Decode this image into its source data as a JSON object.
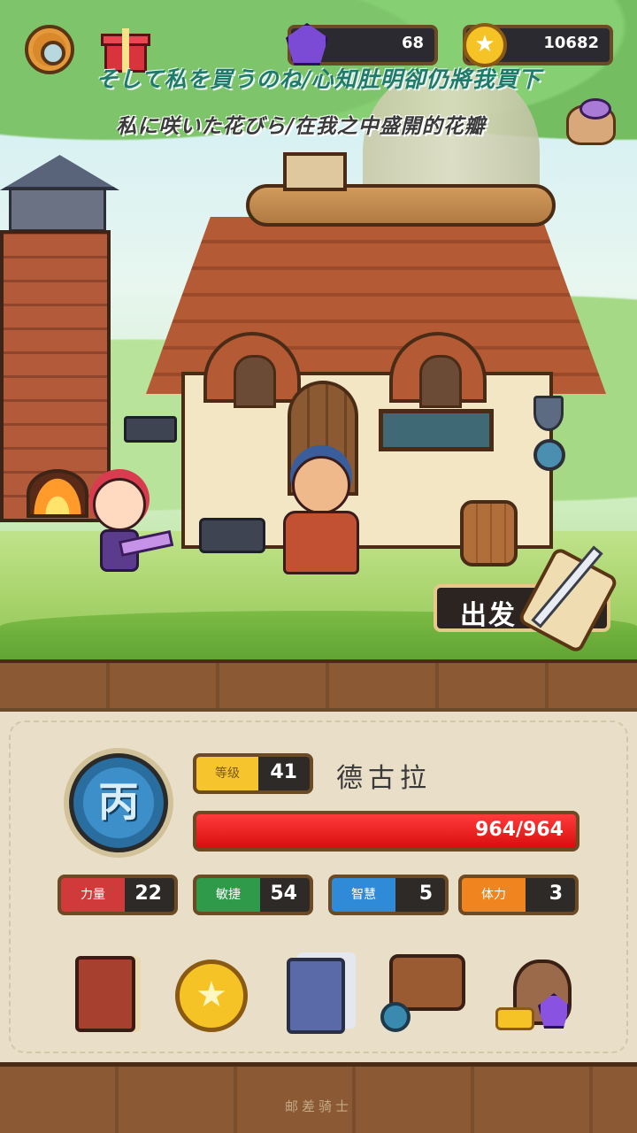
{
  "topbar": {
    "gems": "68",
    "coins": "10682"
  },
  "lyrics": {
    "line1": "そして私を買うのね/心知肚明卻仍將我買下",
    "line2": "私に咲いた花びら/在我之中盛開的花瓣"
  },
  "scene": {
    "depart_label": "出发"
  },
  "hero": {
    "rank": "丙",
    "level_label": "等级",
    "level": "41",
    "name": "德古拉",
    "hp_text": "964/964",
    "hp_fraction": 1.0,
    "stats": {
      "strength_label": "力量",
      "strength": "22",
      "agility_label": "敏捷",
      "agility": "54",
      "wisdom_label": "智慧",
      "wisdom": "5",
      "endurance_label": "体力",
      "endurance": "3"
    }
  },
  "menu": {
    "icons": [
      "hero-book-icon",
      "star-coin-icon",
      "skill-cards-icon",
      "equipment-bag-icon",
      "treasure-sack-icon"
    ]
  },
  "footer": {
    "game_title": "邮差骑士"
  },
  "colors": {
    "hp_bar": "#e61414",
    "level_tag": "#f6c42c",
    "strength": "#d13a3a",
    "agility": "#2f9a4a",
    "wisdom": "#2f8ad8",
    "endurance": "#f0841f",
    "rank_medal": "#3d8fc9"
  }
}
